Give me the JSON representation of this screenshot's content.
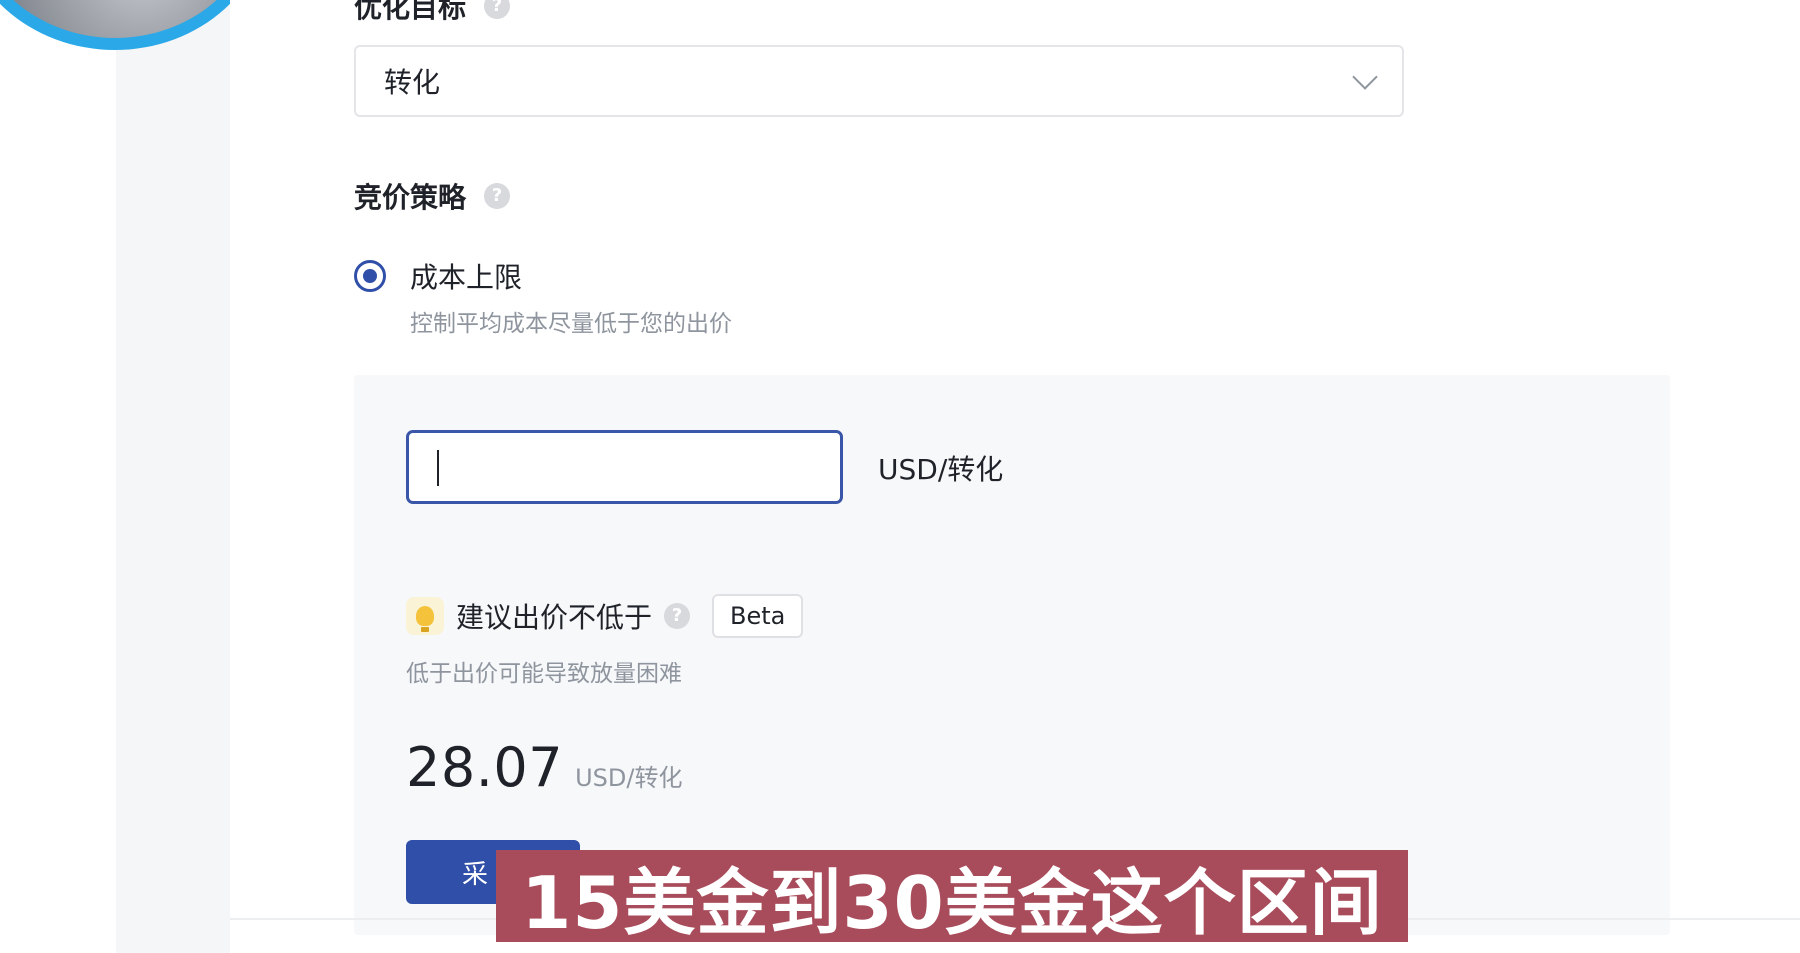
{
  "optimization_goal": {
    "label": "优化目标",
    "value": "转化"
  },
  "bid_strategy": {
    "label": "竞价策略",
    "option": {
      "label": "成本上限",
      "description": "控制平均成本尽量低于您的出价",
      "selected": true
    }
  },
  "bid_input": {
    "value": "",
    "unit": "USD/转化"
  },
  "suggestion": {
    "label": "建议出价不低于",
    "badge": "Beta",
    "description": "低于出价可能导致放量困难",
    "value": "28.07",
    "unit": "USD/转化",
    "adopt_button_label": "采"
  },
  "subtitle_overlay": "15美金到30美金这个区间",
  "colors": {
    "accent": "#2f4fa8",
    "subtitle_bg": "#a84b5a",
    "avatar_ring": "#2aa8e8"
  },
  "icons": {
    "help": "question-circle-icon",
    "dropdown": "chevron-down-icon",
    "suggestion": "lightbulb-icon"
  }
}
